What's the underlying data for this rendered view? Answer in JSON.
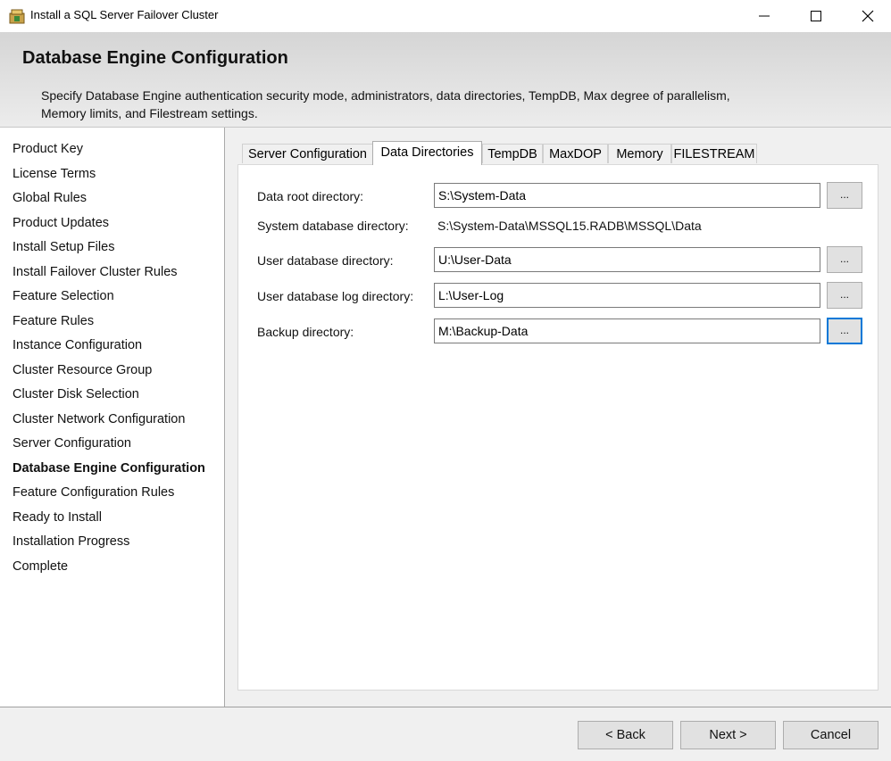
{
  "window": {
    "title": "Install a SQL Server Failover Cluster",
    "controls": [
      "minimize-icon",
      "maximize-icon",
      "close-icon"
    ]
  },
  "header": {
    "title": "Database Engine Configuration",
    "description": "Specify Database Engine authentication security mode, administrators, data directories, TempDB, Max degree of parallelism, Memory limits, and Filestream settings."
  },
  "sidebar": {
    "items": [
      {
        "label": "Product Key"
      },
      {
        "label": "License Terms"
      },
      {
        "label": "Global Rules"
      },
      {
        "label": "Product Updates"
      },
      {
        "label": "Install Setup Files"
      },
      {
        "label": "Install Failover Cluster Rules"
      },
      {
        "label": "Feature Selection"
      },
      {
        "label": "Feature Rules"
      },
      {
        "label": "Instance Configuration"
      },
      {
        "label": "Cluster Resource Group"
      },
      {
        "label": "Cluster Disk Selection"
      },
      {
        "label": "Cluster Network Configuration"
      },
      {
        "label": "Server Configuration"
      },
      {
        "label": "Database Engine Configuration",
        "active": true
      },
      {
        "label": "Feature Configuration Rules"
      },
      {
        "label": "Ready to Install"
      },
      {
        "label": "Installation Progress"
      },
      {
        "label": "Complete"
      }
    ]
  },
  "tabs": [
    {
      "label": "Server Configuration"
    },
    {
      "label": "Data Directories",
      "active": true
    },
    {
      "label": "TempDB"
    },
    {
      "label": "MaxDOP"
    },
    {
      "label": "Memory"
    },
    {
      "label": "FILESTREAM"
    }
  ],
  "data_directories": {
    "data_root": {
      "label": "Data root directory:",
      "value": "S:\\System-Data"
    },
    "system_db": {
      "label": "System database directory:",
      "value": "S:\\System-Data\\MSSQL15.RADB\\MSSQL\\Data"
    },
    "user_db": {
      "label": "User database directory:",
      "value": "U:\\User-Data"
    },
    "user_db_log": {
      "label": "User database log directory:",
      "value": "L:\\User-Log"
    },
    "backup": {
      "label": "Backup directory:",
      "value": "M:\\Backup-Data"
    },
    "browse_label": "..."
  },
  "footer": {
    "back_label": "< Back",
    "next_label": "Next >",
    "cancel_label": "Cancel"
  },
  "colors": {
    "focus_accent": "#0078d7",
    "header_gradient_top": "#d5d5d5",
    "header_gradient_bottom": "#ececec"
  }
}
